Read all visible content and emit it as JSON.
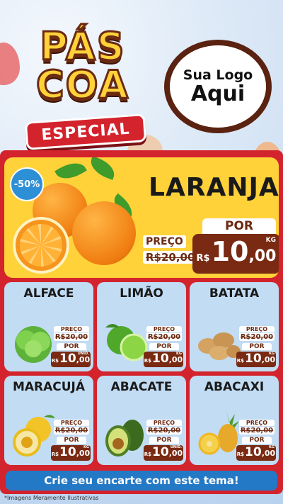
{
  "header": {
    "title_line1": "PÁS",
    "title_line2": "COA",
    "title_badge": "ESPECIAL",
    "logo_line1": "Sua Logo",
    "logo_line2": "Aqui"
  },
  "featured": {
    "discount_badge": "-50%",
    "name": "LARANJA",
    "preco_label": "PREÇO",
    "old_price": "R$20,00",
    "por_label": "POR",
    "currency": "R$",
    "price_int": "10",
    "price_dec": ",00",
    "unit": "KG"
  },
  "products": [
    {
      "name": "ALFACE",
      "preco_label": "PREÇO",
      "old_price": "R$20,00",
      "por_label": "POR",
      "currency": "R$",
      "price_int": "10",
      "price_dec": ",00",
      "unit": "UNID."
    },
    {
      "name": "LIMÃO",
      "preco_label": "PREÇO",
      "old_price": "R$20,00",
      "por_label": "POR",
      "currency": "R$",
      "price_int": "10",
      "price_dec": ",00",
      "unit": "KG"
    },
    {
      "name": "BATATA",
      "preco_label": "PREÇO",
      "old_price": "R$20,00",
      "por_label": "POR",
      "currency": "R$",
      "price_int": "10",
      "price_dec": ",00",
      "unit": "KG"
    },
    {
      "name": "MARACUJÁ",
      "preco_label": "PREÇO",
      "old_price": "R$20,00",
      "por_label": "POR",
      "currency": "R$",
      "price_int": "10",
      "price_dec": ",00",
      "unit": "KG"
    },
    {
      "name": "ABACATE",
      "preco_label": "PREÇO",
      "old_price": "R$20,00",
      "por_label": "POR",
      "currency": "R$",
      "price_int": "10",
      "price_dec": ",00",
      "unit": "UNID."
    },
    {
      "name": "ABACAXI",
      "preco_label": "PREÇO",
      "old_price": "R$20,00",
      "por_label": "POR",
      "currency": "R$",
      "price_int": "10",
      "price_dec": ",00",
      "unit": "KG"
    }
  ],
  "cta": "Crie seu encarte com este tema!",
  "footnote": "*Imagens Meramente Ilustrativas",
  "colors": {
    "red": "#d3232d",
    "yellow": "#ffd23a",
    "brown": "#7a2a12",
    "blue": "#2479c6",
    "card": "#c2dcf3"
  }
}
